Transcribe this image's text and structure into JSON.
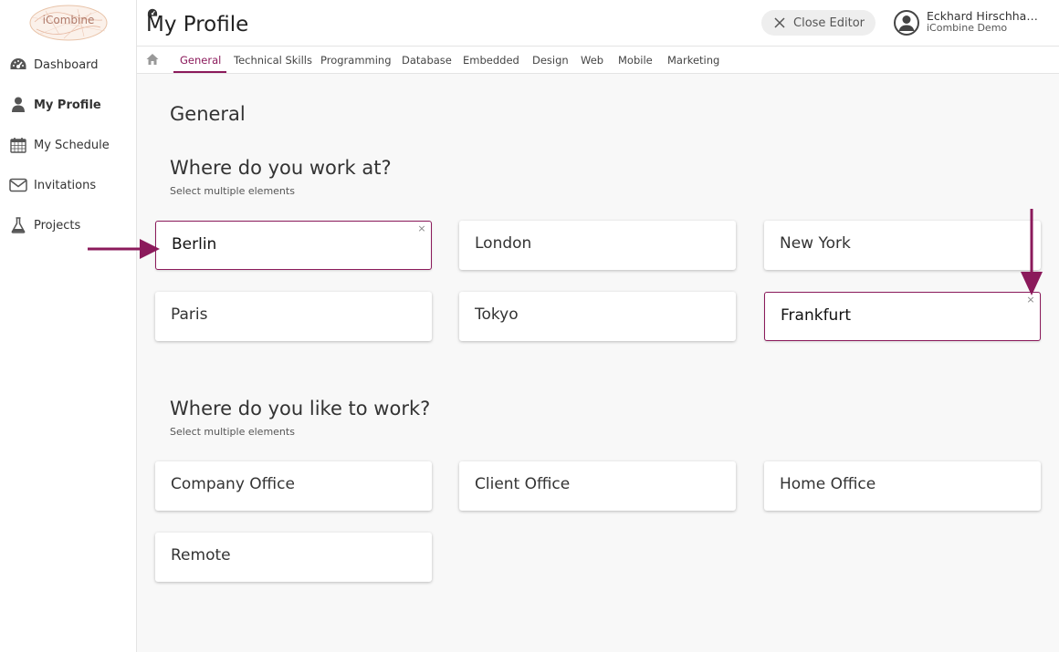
{
  "app": {
    "logo_text": "iCombine"
  },
  "sidebar": {
    "items": [
      {
        "label": "Dashboard",
        "icon": "dashboard-icon"
      },
      {
        "label": "My Profile",
        "icon": "user-icon",
        "active": true
      },
      {
        "label": "My Schedule",
        "icon": "calendar-icon"
      },
      {
        "label": "Invitations",
        "icon": "envelope-icon"
      },
      {
        "label": "Projects",
        "icon": "flask-icon"
      }
    ]
  },
  "header": {
    "title": "My Profile",
    "close_editor_label": "Close Editor",
    "user_name": "Eckhard Hirschha…",
    "user_company": "iCombine Demo"
  },
  "tabs": {
    "items": [
      "General",
      "Technical Skills",
      "Programming",
      "Database",
      "Embedded",
      "Design",
      "Web",
      "Mobile",
      "Marketing"
    ],
    "active": "General"
  },
  "main": {
    "section_title": "General",
    "questions": [
      {
        "title": "Where do you work at?",
        "hint": "Select multiple elements",
        "options": [
          {
            "label": "Berlin",
            "selected": true
          },
          {
            "label": "London",
            "selected": false
          },
          {
            "label": "New York",
            "selected": false
          },
          {
            "label": "Paris",
            "selected": false
          },
          {
            "label": "Tokyo",
            "selected": false
          },
          {
            "label": "Frankfurt",
            "selected": true
          }
        ]
      },
      {
        "title": "Where do you like to work?",
        "hint": "Select multiple elements",
        "options": [
          {
            "label": "Company Office",
            "selected": false
          },
          {
            "label": "Client Office",
            "selected": false
          },
          {
            "label": "Home Office",
            "selected": false
          },
          {
            "label": "Remote",
            "selected": false
          }
        ]
      }
    ],
    "remove_glyph": "×"
  },
  "colors": {
    "accent": "#8b1a5b",
    "background": "#f8f8f8"
  }
}
